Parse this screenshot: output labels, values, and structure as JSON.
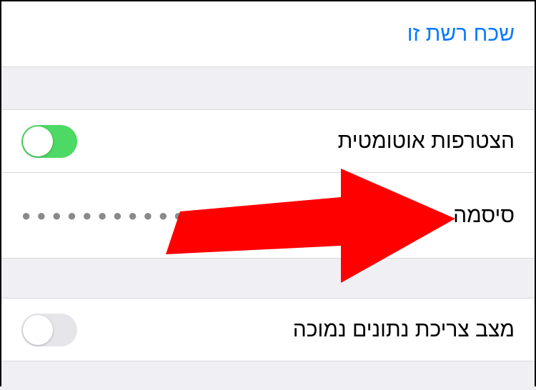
{
  "forget": {
    "label": "שכח רשת זו"
  },
  "autoJoin": {
    "label": "הצטרפות אוטומטית",
    "on": true
  },
  "password": {
    "label": "סיסמה",
    "mask": "●●●●●●●●●●●●"
  },
  "lowData": {
    "label": "מצב צריכת נתונים נמוכה",
    "on": false
  },
  "annotation": {
    "name": "red-arrow"
  }
}
